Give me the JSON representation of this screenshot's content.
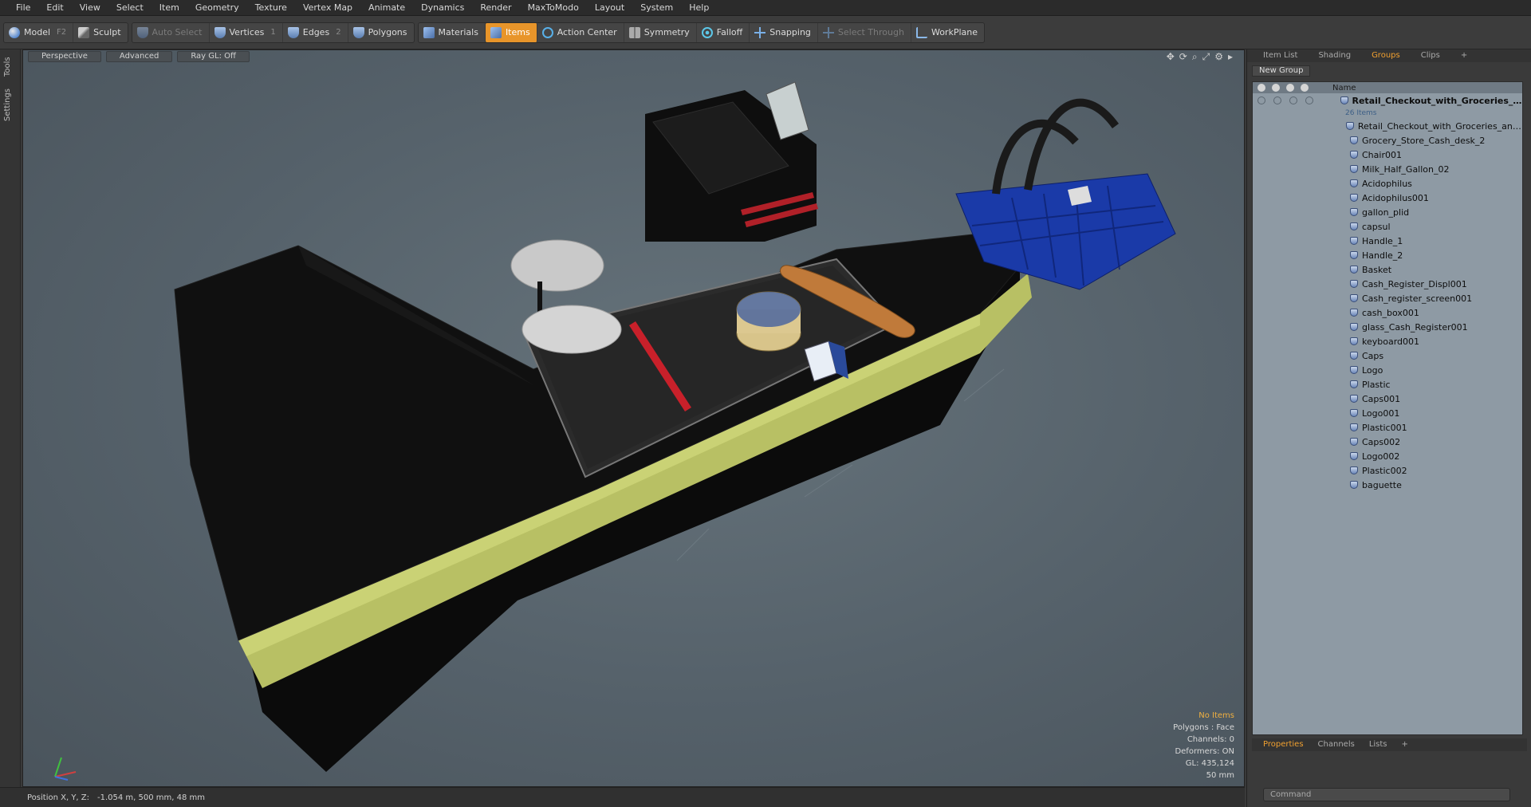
{
  "menu": [
    "File",
    "Edit",
    "View",
    "Select",
    "Item",
    "Geometry",
    "Texture",
    "Vertex Map",
    "Animate",
    "Dynamics",
    "Render",
    "MaxToModo",
    "Layout",
    "System",
    "Help"
  ],
  "toolbar": {
    "model": "Model",
    "model_key": "F2",
    "sculpt": "Sculpt",
    "auto_select": "Auto Select",
    "vertices": "Vertices",
    "vertices_key": "1",
    "edges": "Edges",
    "edges_key": "2",
    "polygons": "Polygons",
    "materials": "Materials",
    "items": "Items",
    "action_center": "Action Center",
    "symmetry": "Symmetry",
    "falloff": "Falloff",
    "snapping": "Snapping",
    "select_through": "Select Through",
    "workplane": "WorkPlane"
  },
  "left_tabs": {
    "tools": "Tools",
    "settings": "Settings"
  },
  "viewport": {
    "view": "Perspective",
    "style": "Advanced",
    "raygl": "Ray GL: Off",
    "info": {
      "selection": "No Items",
      "polygons": "Polygons : Face",
      "channels": "Channels: 0",
      "deformers": "Deformers: ON",
      "gl": "GL: 435,124",
      "scale": "50 mm"
    }
  },
  "status": {
    "label": "Position X, Y, Z:",
    "value": "-1.054 m, 500 mm, 48 mm"
  },
  "panel": {
    "tabs": [
      "Item List",
      "Shading",
      "Groups",
      "Clips"
    ],
    "active_tab": "Groups",
    "new_group": "New Group",
    "name_col": "Name",
    "root": "Retail_Checkout_with_Groceries_ ...",
    "root_count": "26 Items",
    "items": [
      "Retail_Checkout_with_Groceries_and ...",
      "Grocery_Store_Cash_desk_2",
      "Chair001",
      "Milk_Half_Gallon_02",
      "Acidophilus",
      "Acidophilus001",
      "gallon_plid",
      "capsul",
      "Handle_1",
      "Handle_2",
      "Basket",
      "Cash_Register_Displ001",
      "Cash_register_screen001",
      "cash_box001",
      "glass_Cash_Register001",
      "keyboard001",
      "Caps",
      "Logo",
      "Plastic",
      "Caps001",
      "Logo001",
      "Plastic001",
      "Caps002",
      "Logo002",
      "Plastic002",
      "baguette"
    ],
    "bottom_tabs": [
      "Properties",
      "Channels",
      "Lists"
    ],
    "command_placeholder": "Command"
  },
  "colors": {
    "accent": "#e8952a",
    "tree_bg": "#8e9aa4",
    "viewport_bg": "#5b6870"
  }
}
